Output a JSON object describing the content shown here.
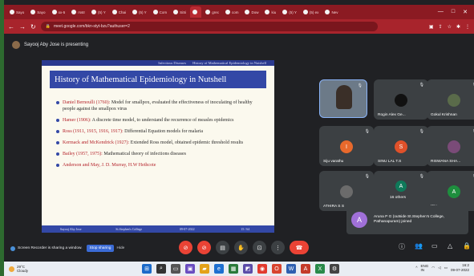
{
  "browser": {
    "tabs": [
      "Sayo",
      "Sayo",
      "ox-5",
      "rsstr",
      "(5) Y",
      "Chai",
      "(5) Y",
      "Com",
      "SiSi",
      "",
      "grec",
      "com",
      "Dow",
      "kiu",
      "(5) Y",
      "(5) ex",
      "Nev"
    ],
    "active_tab_index": 9,
    "url": "meet.google.com/bkn-styt-bzu?authuser=2",
    "window_controls": [
      "—",
      "□",
      "✕"
    ]
  },
  "presenter_banner": "Sayooj Aby Jose is presenting",
  "slide": {
    "header_left": "Infectious Diseases",
    "header_right": "History of Mathematical Epidemiology in Nutshell",
    "title": "History of Mathematical Epidemiology in Nutshell",
    "bullets": [
      {
        "name": "Daniel Bernoulli (1760):",
        "text": " Model for smallpox, evaluated the effectiveness of inoculating of healthy people against the smallpox virus"
      },
      {
        "name": "Hamer (1906):",
        "text": " A discrete time model, to understand the recurrence of measles epidemics"
      },
      {
        "name": "Ross (1911, 1915, 1916, 1917):",
        "text": " Differential Equation models for malaria"
      },
      {
        "name": "Kermack and McKendrick (1927):",
        "text": " Extended Ross model, obtained epidemic threshold results"
      },
      {
        "name": "Bailey (1957, 1975):",
        "text": " Mathematical theory of infections diseases"
      },
      {
        "name": "Anderson and May, J. D. Murray, H.W Hethcote",
        "text": ""
      }
    ],
    "footer": [
      "Sayooj Aby Jose",
      "St.Stephen's College",
      "09-07-2022",
      "15 / 64"
    ]
  },
  "participants": [
    {
      "name": "",
      "kind": "video"
    },
    {
      "name": "Rogin Alex Ge...",
      "kind": "avatar",
      "color": "#111111",
      "initial": ""
    },
    {
      "name": "Gokul Krishnan",
      "kind": "avatar",
      "color": "#5a6b4a",
      "initial": ""
    },
    {
      "name": "Siju varathu",
      "kind": "avatar",
      "color": "#e8692c",
      "initial": "I"
    },
    {
      "name": "SINU LAL T.S",
      "kind": "avatar",
      "color": "#e0512a",
      "initial": "S"
    },
    {
      "name": "RISWANA SHA...",
      "kind": "avatar",
      "color": "#7a4b78",
      "initial": ""
    },
    {
      "name": "ATHIRA S S",
      "kind": "avatar",
      "color": "#6b6b6b",
      "initial": ""
    },
    {
      "name": "16 others",
      "kind": "others",
      "color": "#0f7a5a",
      "initial": "A"
    },
    {
      "name": "You",
      "kind": "avatar",
      "color": "#1e8e3e",
      "initial": "A"
    }
  ],
  "toast": {
    "initial": "A",
    "text": "Aruna P G (outside St.Stephen's College, Pathanapuram) joined"
  },
  "recording": {
    "message": "Screen Recorder is sharing a window.",
    "stop_label": "Stop sharing",
    "hide_label": "Hide"
  },
  "taskbar": {
    "temp": "29°C",
    "weather": "Cloudy",
    "lang": "ENG\nIN",
    "time": "16:2",
    "date": "09-07-2022"
  },
  "colors": {
    "accent": "#a8242c",
    "slide_blue": "#3348a6",
    "end_call": "#ea4335"
  }
}
